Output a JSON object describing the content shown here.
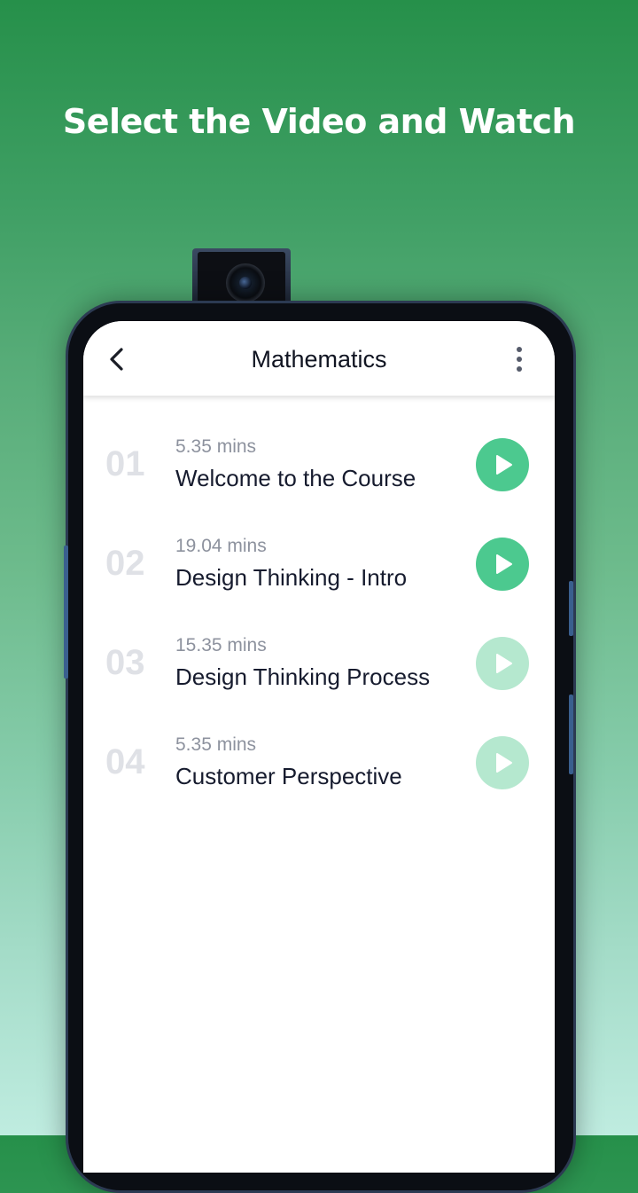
{
  "headline": "Select the Video and Watch",
  "appbar": {
    "title": "Mathematics"
  },
  "videos": [
    {
      "number": "01",
      "duration": "5.35 mins",
      "title": "Welcome to the Course",
      "active": true
    },
    {
      "number": "02",
      "duration": "19.04 mins",
      "title": "Design Thinking - Intro",
      "active": true
    },
    {
      "number": "03",
      "duration": "15.35 mins",
      "title": "Design Thinking Process",
      "active": false
    },
    {
      "number": "04",
      "duration": "5.35 mins",
      "title": "Customer Perspective",
      "active": false
    }
  ],
  "colors": {
    "play_active": "#4cc98f",
    "play_inactive": "#b5e8cf",
    "background_top": "#26904a",
    "background_bottom": "#bfece0"
  },
  "icons": {
    "back": "chevron-left-icon",
    "more": "more-vertical-icon",
    "play": "play-icon"
  }
}
